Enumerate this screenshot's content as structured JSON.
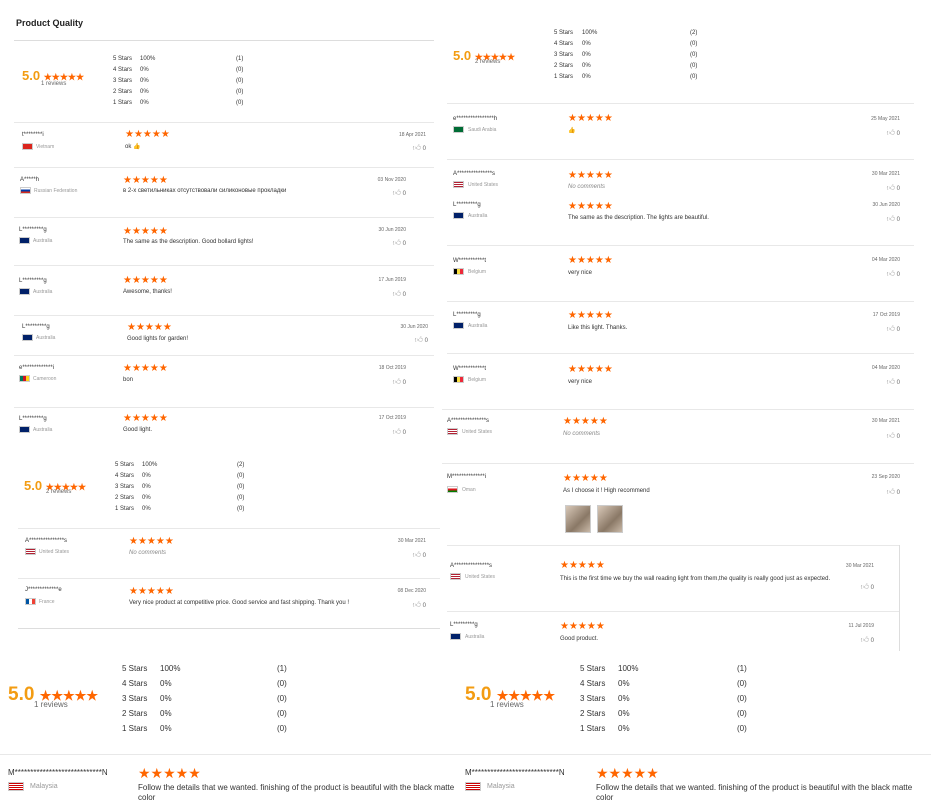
{
  "panel1": {
    "title": "Product Quality",
    "summary": {
      "score": "5.0",
      "stars": "★★★★★",
      "count": "1 reviews",
      "dist": [
        {
          "label": "5 Stars",
          "pct": "100%",
          "num": "(1)"
        },
        {
          "label": "4 Stars",
          "pct": "0%",
          "num": "(0)"
        },
        {
          "label": "3 Stars",
          "pct": "0%",
          "num": "(0)"
        },
        {
          "label": "2 Stars",
          "pct": "0%",
          "num": "(0)"
        },
        {
          "label": "1 Stars",
          "pct": "0%",
          "num": "(0)"
        }
      ]
    },
    "reviews": [
      {
        "name": "t********i",
        "country": "Vietnam",
        "flag": "vn",
        "stars": "★★★★★",
        "text": "ok 👍",
        "date": "18 Apr 2021",
        "likes": "0"
      },
      {
        "name": "A*****h",
        "country": "Russian Federation",
        "flag": "ru",
        "stars": "★★★★★",
        "text": "в 2-х светильниках отсутствовали силиконовые прокладки",
        "date": "03 Nov 2020",
        "likes": "0"
      },
      {
        "name": "L*********g",
        "country": "Australia",
        "flag": "au",
        "stars": "★★★★★",
        "text": "The same as the description. Good bollard lights!",
        "date": "30 Jun 2020",
        "likes": "0"
      },
      {
        "name": "L*********g",
        "country": "Australia",
        "flag": "au",
        "stars": "★★★★★",
        "text": "Awesome, thanks!",
        "date": "17 Jun 2019",
        "likes": "0"
      },
      {
        "name": "L*********g",
        "country": "Australia",
        "flag": "au",
        "stars": "★★★★★",
        "text": "Good lights for garden!",
        "date": "30 Jun 2020",
        "likes": "0"
      },
      {
        "name": "e*************i",
        "country": "Cameroon",
        "flag": "cm",
        "stars": "★★★★★",
        "text": "bon",
        "date": "18 Oct 2019",
        "likes": "0"
      },
      {
        "name": "L*********g",
        "country": "Australia",
        "flag": "au",
        "stars": "★★★★★",
        "text": "Good light.",
        "date": "17 Oct 2019",
        "likes": "0"
      }
    ]
  },
  "panel2": {
    "summary": {
      "score": "5.0",
      "stars": "★★★★★",
      "count": "2 reviews",
      "dist": [
        {
          "label": "5 Stars",
          "pct": "100%",
          "num": "(2)"
        },
        {
          "label": "4 Stars",
          "pct": "0%",
          "num": "(0)"
        },
        {
          "label": "3 Stars",
          "pct": "0%",
          "num": "(0)"
        },
        {
          "label": "2 Stars",
          "pct": "0%",
          "num": "(0)"
        },
        {
          "label": "1 Stars",
          "pct": "0%",
          "num": "(0)"
        }
      ]
    },
    "reviews": [
      {
        "name": "A***************s",
        "country": "United States",
        "flag": "us",
        "stars": "★★★★★",
        "text": "No comments",
        "date": "30 Mar 2021",
        "likes": "0"
      },
      {
        "name": "J*************e",
        "country": "France",
        "flag": "fr",
        "stars": "★★★★★",
        "text": "Very nice product at competitive price. Good service and fast shipping. Thank you !",
        "date": "08 Dec 2020",
        "likes": "0"
      }
    ]
  },
  "panel3": {
    "summary": {
      "score": "5.0",
      "stars": "★★★★★",
      "count": "1 reviews",
      "dist": [
        {
          "label": "5 Stars",
          "pct": "100%",
          "num": "(1)"
        },
        {
          "label": "4 Stars",
          "pct": "0%",
          "num": "(0)"
        },
        {
          "label": "3 Stars",
          "pct": "0%",
          "num": "(0)"
        },
        {
          "label": "2 Stars",
          "pct": "0%",
          "num": "(0)"
        },
        {
          "label": "1 Stars",
          "pct": "0%",
          "num": "(0)"
        }
      ]
    },
    "review": {
      "name": "M****************************N",
      "country": "Malaysia",
      "flag": "my",
      "stars": "★★★★★",
      "text": "Follow the details that we wanted. finishing of the product is beautiful with the black matte color"
    }
  },
  "panel4": {
    "summary": {
      "score": "5.0",
      "stars": "★★★★★",
      "count": "2 reviews",
      "dist": [
        {
          "label": "5 Stars",
          "pct": "100%",
          "num": "(2)"
        },
        {
          "label": "4 Stars",
          "pct": "0%",
          "num": "(0)"
        },
        {
          "label": "3 Stars",
          "pct": "0%",
          "num": "(0)"
        },
        {
          "label": "2 Stars",
          "pct": "0%",
          "num": "(0)"
        },
        {
          "label": "1 Stars",
          "pct": "0%",
          "num": "(0)"
        }
      ]
    },
    "reviews": [
      {
        "name": "e****************h",
        "country": "Saudi Arabia",
        "flag": "sa",
        "stars": "★★★★★",
        "text": "👍",
        "date": "25 May 2021",
        "likes": "0"
      },
      {
        "name": "A***************s",
        "country": "United States",
        "flag": "us",
        "stars": "★★★★★",
        "text": "No comments",
        "date": "30 Mar 2021",
        "likes": "0"
      },
      {
        "name": "L*********g",
        "country": "Australia",
        "flag": "au",
        "stars": "★★★★★",
        "text": "The same as the description. The lights are beautiful.",
        "date": "30 Jun 2020",
        "likes": "0"
      },
      {
        "name": "W***********t",
        "country": "Belgium",
        "flag": "be",
        "stars": "★★★★★",
        "text": "very nice",
        "date": "04 Mar 2020",
        "likes": "0"
      },
      {
        "name": "L*********g",
        "country": "Australia",
        "flag": "au",
        "stars": "★★★★★",
        "text": "Like this light. Thanks.",
        "date": "17 Oct 2019",
        "likes": "0"
      },
      {
        "name": "W***********t",
        "country": "Belgium",
        "flag": "be",
        "stars": "★★★★★",
        "text": "very nice",
        "date": "04 Mar 2020",
        "likes": "0"
      },
      {
        "name": "A***************s",
        "country": "United States",
        "flag": "us",
        "stars": "★★★★★",
        "text": "No comments",
        "date": "30 Mar 2021",
        "likes": "0"
      },
      {
        "name": "M**************i",
        "country": "Oman",
        "flag": "om",
        "stars": "★★★★★",
        "text": "As I choose it ! High recommend",
        "date": "23 Sep 2020",
        "likes": "0"
      },
      {
        "name": "A***************s",
        "country": "United States",
        "flag": "us",
        "stars": "★★★★★",
        "text": "This is the first time we buy the wall reading light from them,the quality is really good just as expected.",
        "date": "30 Mar 2021",
        "likes": "0"
      },
      {
        "name": "L*********g",
        "country": "Australia",
        "flag": "au",
        "stars": "★★★★★",
        "text": "Good product.",
        "date": "11 Jul 2019",
        "likes": "0"
      }
    ]
  },
  "panel5": {
    "summary": {
      "score": "5.0",
      "stars": "★★★★★",
      "count": "1 reviews",
      "dist": [
        {
          "label": "5 Stars",
          "pct": "100%",
          "num": "(1)"
        },
        {
          "label": "4 Stars",
          "pct": "0%",
          "num": "(0)"
        },
        {
          "label": "3 Stars",
          "pct": "0%",
          "num": "(0)"
        },
        {
          "label": "2 Stars",
          "pct": "0%",
          "num": "(0)"
        },
        {
          "label": "1 Stars",
          "pct": "0%",
          "num": "(0)"
        }
      ]
    },
    "review": {
      "name": "M****************************N",
      "country": "Malaysia",
      "flag": "my",
      "stars": "★★★★★",
      "text": "Follow the details that we wanted. finishing of the product is beautiful with the black matte color"
    }
  }
}
